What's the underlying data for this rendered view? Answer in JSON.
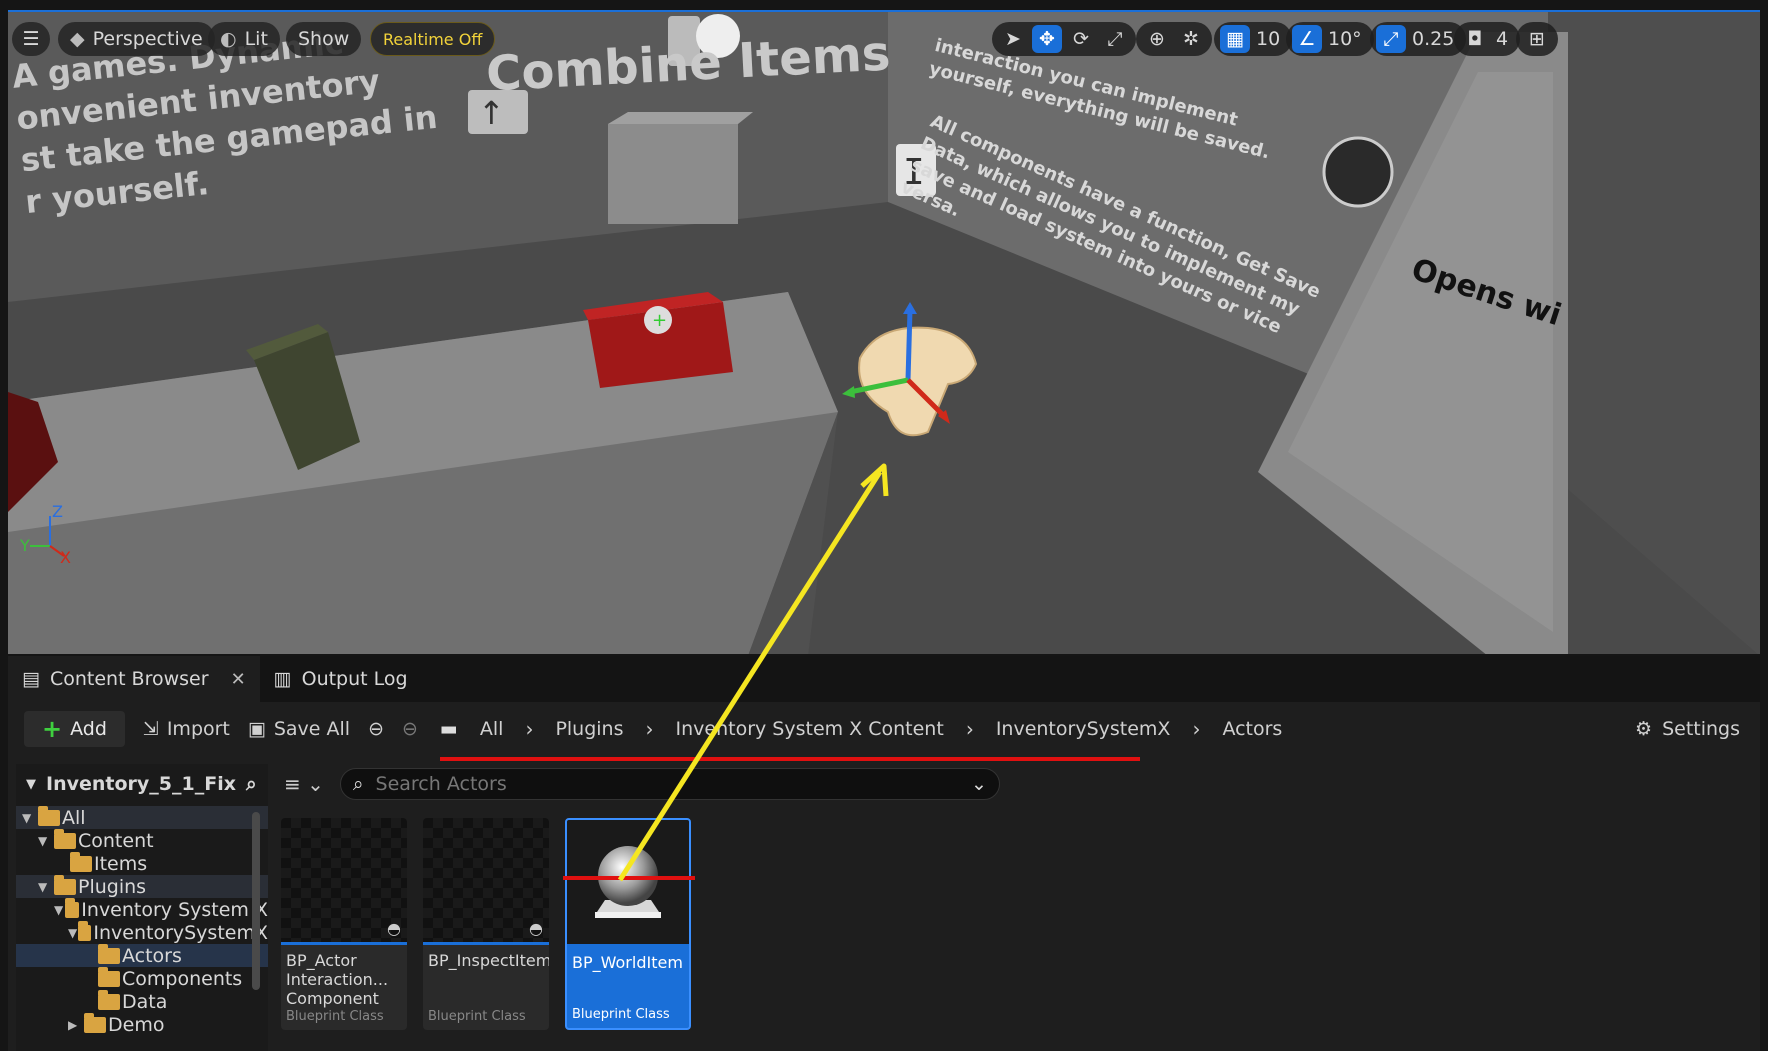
{
  "viewport": {
    "menu_icon": "hamburger-icon",
    "perspective": "Perspective",
    "lit": "Lit",
    "show": "Show",
    "realtime": "Realtime Off",
    "grid_snap": "10",
    "rotation_snap": "10°",
    "scale_snap": "0.25",
    "camera_speed": "4",
    "scene_text": {
      "title": "Combine Items",
      "left_wall": [
        "A games. Dynamic",
        "onvenient inventory",
        "st take the gamepad in",
        "r yourself."
      ],
      "right_wall_top": [
        "interaction you can implement",
        "yourself, everything will be saved."
      ],
      "right_wall_mid": [
        "All components have a function, Get Save",
        "Data, which allows you to implement my",
        "save and load system into yours or vice",
        "versa."
      ],
      "door": "Opens wi"
    },
    "axes": {
      "z": "Z",
      "y": "Y",
      "x": "X"
    }
  },
  "tabs": [
    {
      "label": "Content Browser",
      "icon": "content-browser-icon"
    },
    {
      "label": "Output Log",
      "icon": "output-log-icon"
    }
  ],
  "toolbar": {
    "add": "Add",
    "import": "Import",
    "save_all": "Save All",
    "settings": "Settings"
  },
  "breadcrumb": [
    "All",
    "Plugins",
    "Inventory System X Content",
    "InventorySystemX",
    "Actors"
  ],
  "sidebar": {
    "project": "Inventory_5_1_Fix",
    "tree": [
      {
        "label": "All",
        "depth": 0,
        "arrow": "open"
      },
      {
        "label": "Content",
        "depth": 1,
        "arrow": "open"
      },
      {
        "label": "Items",
        "depth": 2,
        "arrow": "none"
      },
      {
        "label": "Plugins",
        "depth": 1,
        "arrow": "open"
      },
      {
        "label": "Inventory System X",
        "depth": 2,
        "arrow": "open"
      },
      {
        "label": "InventorySystemX",
        "depth": 3,
        "arrow": "open"
      },
      {
        "label": "Actors",
        "depth": 4,
        "arrow": "none"
      },
      {
        "label": "Components",
        "depth": 4,
        "arrow": "none"
      },
      {
        "label": "Data",
        "depth": 4,
        "arrow": "none"
      },
      {
        "label": "Demo",
        "depth": 4,
        "arrow": "closed"
      }
    ]
  },
  "search": {
    "placeholder": "Search Actors"
  },
  "assets": [
    {
      "name": "BP_Actor Interaction... Component",
      "type": "Blueprint Class"
    },
    {
      "name": "BP_InspectItem",
      "type": "Blueprint Class"
    },
    {
      "name": "BP_WorldItem",
      "type": "Blueprint Class"
    }
  ],
  "colors": {
    "accent": "#1a6fd8",
    "annotation_red": "#e01010",
    "annotation_yellow": "#f5e621",
    "folder": "#d9a441"
  }
}
